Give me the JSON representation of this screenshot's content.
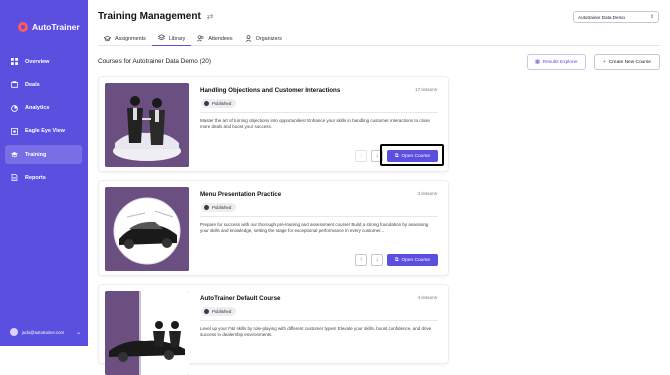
{
  "app": {
    "name": "AutoTrainer"
  },
  "sidebar": {
    "items": [
      {
        "label": "Overview",
        "icon": "grid-icon"
      },
      {
        "label": "Deals",
        "icon": "deals-icon"
      },
      {
        "label": "Analytics",
        "icon": "analytics-icon"
      },
      {
        "label": "Eagle Eye View",
        "icon": "eye-icon"
      },
      {
        "label": "Training",
        "icon": "graduation-cap-icon",
        "active": true
      },
      {
        "label": "Reports",
        "icon": "reports-icon"
      }
    ],
    "user_email": "judo@autotrainer.com"
  },
  "header": {
    "title": "Training Management",
    "org_select": "Autotrainer Data Demo"
  },
  "tabs": [
    {
      "label": "Assignments"
    },
    {
      "label": "Library",
      "active": true
    },
    {
      "label": "Attendees"
    },
    {
      "label": "Organizers"
    }
  ],
  "library": {
    "section_title": "Courses for Autotrainer Data Demo (20)",
    "results_explorer_label": "Results Explorer",
    "create_course_label": "Create New Course",
    "open_label": "Open Course",
    "courses": [
      {
        "title": "Handling Objections and Customer Interactions",
        "lessons": "17 lessons",
        "status": "Published",
        "description": "Master the art of turning objections into opportunities! Enhance your skills in handling customer interactions to close more deals and boost your success."
      },
      {
        "title": "Menu Presentation Practice",
        "lessons": "3 lessons",
        "status": "Published",
        "description": "Prepare for success with our thorough pre-training and assessment course! Build a strong foundation by assessing your skills and knowledge, setting the stage for exceptional performance in every customer..."
      },
      {
        "title": "AutoTrainer Default Course",
        "lessons": "4 lessons",
        "status": "Published",
        "description": "Level up your F&I skills by role-playing with different customer types! Elevate your skills, boost confidence, and drive success in dealership environments."
      }
    ]
  },
  "colors": {
    "accent": "#5b4fe0",
    "sidebar": "#5b4fe0",
    "logo": "#ff5a5a",
    "image_bg": "#6b4f80"
  }
}
